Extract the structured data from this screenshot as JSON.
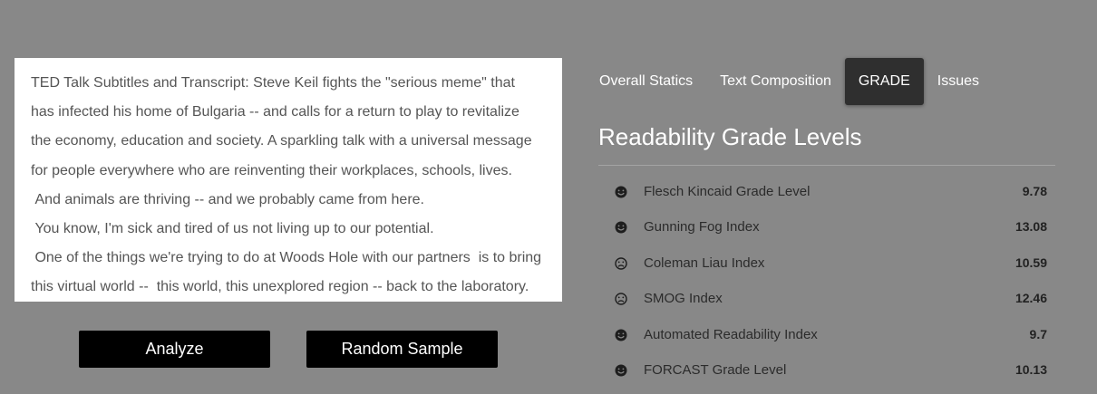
{
  "text_sample": {
    "lines": [
      "TED Talk Subtitles and Transcript: Steve Keil fights the \"serious meme\" that",
      "has infected his home of Bulgaria -- and calls for a return to play to revitalize",
      "the economy, education and society. A sparkling talk with a universal message",
      "for people everywhere who are reinventing their workplaces, schools, lives.",
      " And animals are thriving -- and we probably came from here.",
      " You know, I'm sick and tired of us not living up to our potential.",
      " One of the things we're trying to do at Woods Hole with our partners  is to bring",
      "this virtual world --  this world, this unexplored region -- back to the laboratory."
    ]
  },
  "buttons": {
    "analyze": "Analyze",
    "random_sample": "Random Sample"
  },
  "tabs": [
    {
      "label": "Overall Statics",
      "active": false
    },
    {
      "label": "Text Composition",
      "active": false
    },
    {
      "label": "GRADE",
      "active": true
    },
    {
      "label": "Issues",
      "active": false
    }
  ],
  "grade_section": {
    "title": "Readability Grade Levels",
    "rows": [
      {
        "label": "Flesch Kincaid Grade Level",
        "value": "9.78",
        "icon": "smile-icon"
      },
      {
        "label": "Gunning Fog Index",
        "value": "13.08",
        "icon": "smile-icon"
      },
      {
        "label": "Coleman Liau Index",
        "value": "10.59",
        "icon": "frown-icon"
      },
      {
        "label": "SMOG Index",
        "value": "12.46",
        "icon": "frown-icon"
      },
      {
        "label": "Automated Readability Index",
        "value": "9.7",
        "icon": "smile-icon"
      },
      {
        "label": "FORCAST Grade Level",
        "value": "10.13",
        "icon": "smile-icon"
      }
    ]
  },
  "colors": {
    "background": "#888888",
    "panel": "#ffffff",
    "button": "#000000",
    "active_tab": "#2f2f2f"
  }
}
